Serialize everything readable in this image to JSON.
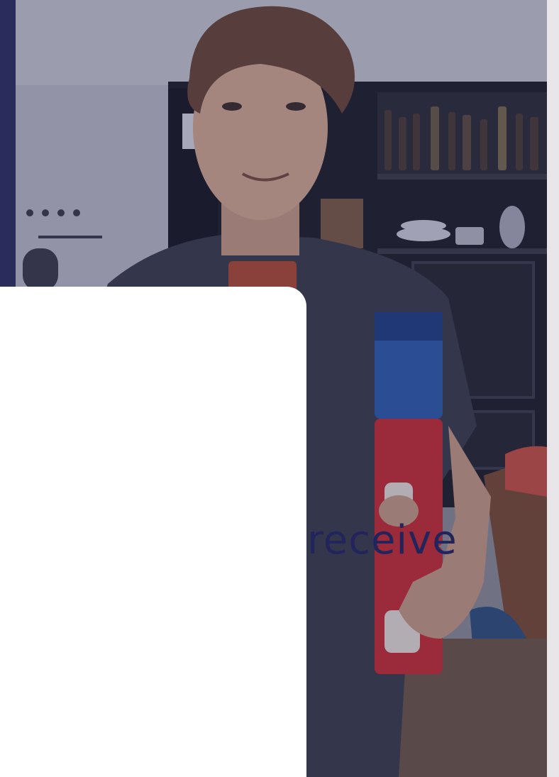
{
  "hero": {
    "image_alt_icon": "photo-person-holding-cans",
    "overlay_color": "#2b2e58"
  },
  "card": {
    "headline_fragment": "receive",
    "text_color": "#22255c",
    "background": "#ffffff"
  }
}
